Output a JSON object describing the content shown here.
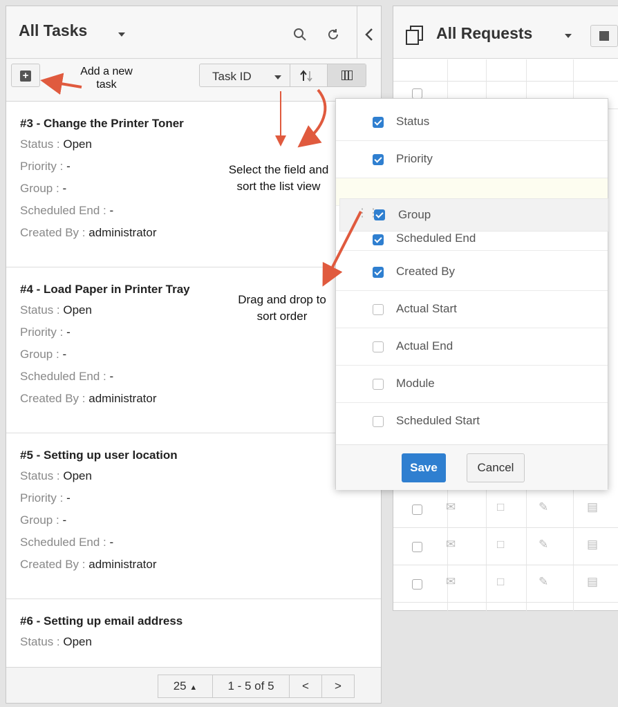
{
  "left_panel": {
    "title": "All Tasks",
    "icons": [
      "search-icon",
      "refresh-icon",
      "collapse-icon"
    ],
    "toolbar": {
      "add_icon": "plus-icon",
      "sort_field": "Task ID",
      "sort_icon": "sort-direction-icon",
      "columns_icon": "columns-icon"
    },
    "tasks": [
      {
        "title": "#3 - Change the Printer Toner",
        "status_label": "Status :",
        "status": "Open",
        "priority_label": "Priority :",
        "priority": "-",
        "group_label": "Group :",
        "group": "-",
        "scheduled_end_label": "Scheduled End :",
        "scheduled_end": "-",
        "created_by_label": "Created By :",
        "created_by": "administrator"
      },
      {
        "title": "#4 - Load Paper in Printer Tray",
        "status_label": "Status :",
        "status": "Open",
        "priority_label": "Priority :",
        "priority": "-",
        "group_label": "Group :",
        "group": "-",
        "scheduled_end_label": "Scheduled End :",
        "scheduled_end": "-",
        "created_by_label": "Created By :",
        "created_by": "administrator"
      },
      {
        "title": "#5 - Setting up user location",
        "status_label": "Status :",
        "status": "Open",
        "priority_label": "Priority :",
        "priority": "-",
        "group_label": "Group :",
        "group": "-",
        "scheduled_end_label": "Scheduled End :",
        "scheduled_end": "-",
        "created_by_label": "Created By :",
        "created_by": "administrator"
      },
      {
        "title": "#6 - Setting up email address",
        "status_label": "Status :",
        "status": "Open"
      }
    ],
    "pager": {
      "page_size": "25",
      "range": "1 - 5 of 5",
      "prev": "<",
      "next": ">"
    }
  },
  "right_panel": {
    "title": "All Requests",
    "title_icon": "copy-icon",
    "row_icons": [
      "mail-icon",
      "add-note-icon",
      "edit-icon",
      "document-icon"
    ]
  },
  "column_chooser": {
    "items": [
      {
        "label": "Status",
        "checked": true
      },
      {
        "label": "Priority",
        "checked": true
      },
      {
        "label": "Group",
        "checked": true,
        "dragging": true
      },
      {
        "label": "Scheduled End",
        "checked": true
      },
      {
        "label": "Created By",
        "checked": true
      },
      {
        "label": "Actual Start",
        "checked": false
      },
      {
        "label": "Actual End",
        "checked": false
      },
      {
        "label": "Module",
        "checked": false
      },
      {
        "label": "Scheduled Start",
        "checked": false
      }
    ],
    "save_label": "Save",
    "cancel_label": "Cancel"
  },
  "annotations": {
    "add_task": "Add a new task",
    "sort": "Select the field and sort the list view",
    "drag": "Drag and drop to sort order"
  },
  "colors": {
    "accent": "#2f7fd0",
    "arrow": "#e05a3e"
  }
}
